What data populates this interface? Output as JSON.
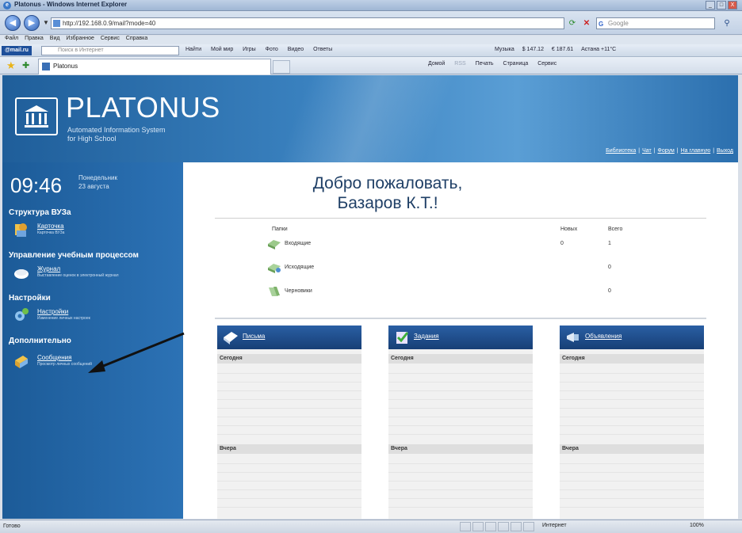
{
  "window": {
    "title": "Platonus - Windows Internet Explorer",
    "min": "_",
    "max": "□",
    "close": "X"
  },
  "address": {
    "url": "http://192.168.0.9/mail?mode=40",
    "search_placeholder": "Google"
  },
  "menu": [
    "Файл",
    "Правка",
    "Вид",
    "Избранное",
    "Сервис",
    "Справка"
  ],
  "toolbar": {
    "mail_label": "@mail.ru",
    "search_placeholder": "Поиск в Интернет",
    "links": [
      "Найти",
      "Мой мир",
      "Игры",
      "Фото",
      "Видео",
      "Ответы"
    ],
    "weather": [
      "Музыка",
      "$ 147.12",
      "€ 187.61",
      "Астана +11°C"
    ]
  },
  "tabs": {
    "active_tab": "Platonus",
    "commands": [
      "Домой",
      "RSS",
      "Печать",
      "Страница",
      "Сервис"
    ]
  },
  "header": {
    "logo_title": "PLATONUS",
    "logo_sub1": "Automated Information System",
    "logo_sub2": "for High School",
    "links": [
      "Библиотека",
      "Чат",
      "Форум",
      "На главную",
      "Выход"
    ]
  },
  "sidebar": {
    "time": "09:46",
    "weekday": "Понедельник",
    "date": "23 августа",
    "sections": [
      {
        "title": "Структура ВУЗа",
        "items": [
          {
            "label": "Карточка",
            "desc": "Карточка ВУЗа"
          }
        ]
      },
      {
        "title": "Управление учебным процессом",
        "items": [
          {
            "label": "Журнал",
            "desc": "Выставление оценок в электронный журнал"
          }
        ]
      },
      {
        "title": "Настройки",
        "items": [
          {
            "label": "Настройки",
            "desc": "Изменение личных настроек"
          }
        ]
      },
      {
        "title": "Дополнительно",
        "items": [
          {
            "label": "Сообщения",
            "desc": "Просмотр личных сообщений"
          }
        ]
      }
    ]
  },
  "main": {
    "welcome_line1": "Добро пожаловать,",
    "welcome_line2": "Базаров К.Т.!",
    "folders_header": "Папки",
    "new_header": "Новых",
    "total_header": "Всего",
    "folders": [
      {
        "name": "Входящие",
        "new": "0",
        "total": "1"
      },
      {
        "name": "Исходящие",
        "new": "",
        "total": "0"
      },
      {
        "name": "Черновики",
        "new": "",
        "total": "0"
      }
    ],
    "panels": [
      {
        "title": "Письма",
        "today": "Сегодня",
        "yesterday": "Вчера"
      },
      {
        "title": "Задания",
        "today": "Сегодня",
        "yesterday": "Вчера"
      },
      {
        "title": "Объявления",
        "today": "Сегодня",
        "yesterday": "Вчера"
      }
    ]
  },
  "status": {
    "text": "Готово",
    "zone": "Интернет",
    "zoom": "100%"
  },
  "colors": {
    "header_blue": "#2c72b5",
    "panel_header": "#1f4f8e",
    "welcome_text": "#1f3f66"
  }
}
